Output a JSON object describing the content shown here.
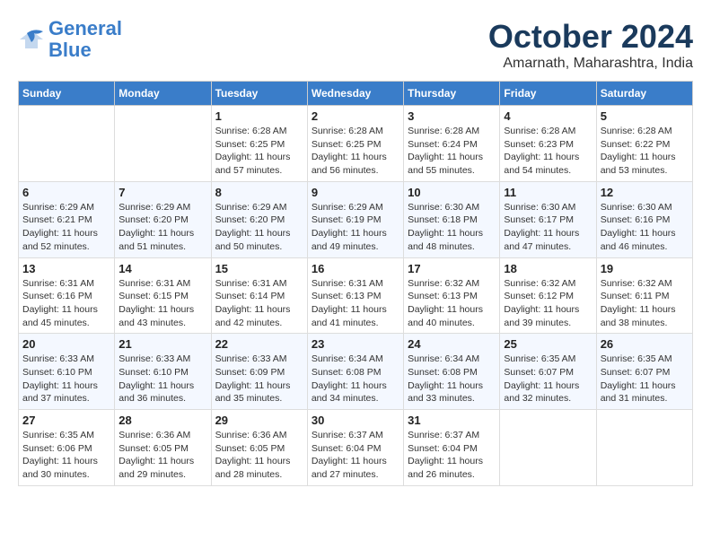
{
  "header": {
    "logo_line1": "General",
    "logo_line2": "Blue",
    "month": "October 2024",
    "location": "Amarnath, Maharashtra, India"
  },
  "days_of_week": [
    "Sunday",
    "Monday",
    "Tuesday",
    "Wednesday",
    "Thursday",
    "Friday",
    "Saturday"
  ],
  "weeks": [
    [
      {
        "day": "",
        "info": ""
      },
      {
        "day": "",
        "info": ""
      },
      {
        "day": "1",
        "info": "Sunrise: 6:28 AM\nSunset: 6:25 PM\nDaylight: 11 hours and 57 minutes."
      },
      {
        "day": "2",
        "info": "Sunrise: 6:28 AM\nSunset: 6:25 PM\nDaylight: 11 hours and 56 minutes."
      },
      {
        "day": "3",
        "info": "Sunrise: 6:28 AM\nSunset: 6:24 PM\nDaylight: 11 hours and 55 minutes."
      },
      {
        "day": "4",
        "info": "Sunrise: 6:28 AM\nSunset: 6:23 PM\nDaylight: 11 hours and 54 minutes."
      },
      {
        "day": "5",
        "info": "Sunrise: 6:28 AM\nSunset: 6:22 PM\nDaylight: 11 hours and 53 minutes."
      }
    ],
    [
      {
        "day": "6",
        "info": "Sunrise: 6:29 AM\nSunset: 6:21 PM\nDaylight: 11 hours and 52 minutes."
      },
      {
        "day": "7",
        "info": "Sunrise: 6:29 AM\nSunset: 6:20 PM\nDaylight: 11 hours and 51 minutes."
      },
      {
        "day": "8",
        "info": "Sunrise: 6:29 AM\nSunset: 6:20 PM\nDaylight: 11 hours and 50 minutes."
      },
      {
        "day": "9",
        "info": "Sunrise: 6:29 AM\nSunset: 6:19 PM\nDaylight: 11 hours and 49 minutes."
      },
      {
        "day": "10",
        "info": "Sunrise: 6:30 AM\nSunset: 6:18 PM\nDaylight: 11 hours and 48 minutes."
      },
      {
        "day": "11",
        "info": "Sunrise: 6:30 AM\nSunset: 6:17 PM\nDaylight: 11 hours and 47 minutes."
      },
      {
        "day": "12",
        "info": "Sunrise: 6:30 AM\nSunset: 6:16 PM\nDaylight: 11 hours and 46 minutes."
      }
    ],
    [
      {
        "day": "13",
        "info": "Sunrise: 6:31 AM\nSunset: 6:16 PM\nDaylight: 11 hours and 45 minutes."
      },
      {
        "day": "14",
        "info": "Sunrise: 6:31 AM\nSunset: 6:15 PM\nDaylight: 11 hours and 43 minutes."
      },
      {
        "day": "15",
        "info": "Sunrise: 6:31 AM\nSunset: 6:14 PM\nDaylight: 11 hours and 42 minutes."
      },
      {
        "day": "16",
        "info": "Sunrise: 6:31 AM\nSunset: 6:13 PM\nDaylight: 11 hours and 41 minutes."
      },
      {
        "day": "17",
        "info": "Sunrise: 6:32 AM\nSunset: 6:13 PM\nDaylight: 11 hours and 40 minutes."
      },
      {
        "day": "18",
        "info": "Sunrise: 6:32 AM\nSunset: 6:12 PM\nDaylight: 11 hours and 39 minutes."
      },
      {
        "day": "19",
        "info": "Sunrise: 6:32 AM\nSunset: 6:11 PM\nDaylight: 11 hours and 38 minutes."
      }
    ],
    [
      {
        "day": "20",
        "info": "Sunrise: 6:33 AM\nSunset: 6:10 PM\nDaylight: 11 hours and 37 minutes."
      },
      {
        "day": "21",
        "info": "Sunrise: 6:33 AM\nSunset: 6:10 PM\nDaylight: 11 hours and 36 minutes."
      },
      {
        "day": "22",
        "info": "Sunrise: 6:33 AM\nSunset: 6:09 PM\nDaylight: 11 hours and 35 minutes."
      },
      {
        "day": "23",
        "info": "Sunrise: 6:34 AM\nSunset: 6:08 PM\nDaylight: 11 hours and 34 minutes."
      },
      {
        "day": "24",
        "info": "Sunrise: 6:34 AM\nSunset: 6:08 PM\nDaylight: 11 hours and 33 minutes."
      },
      {
        "day": "25",
        "info": "Sunrise: 6:35 AM\nSunset: 6:07 PM\nDaylight: 11 hours and 32 minutes."
      },
      {
        "day": "26",
        "info": "Sunrise: 6:35 AM\nSunset: 6:07 PM\nDaylight: 11 hours and 31 minutes."
      }
    ],
    [
      {
        "day": "27",
        "info": "Sunrise: 6:35 AM\nSunset: 6:06 PM\nDaylight: 11 hours and 30 minutes."
      },
      {
        "day": "28",
        "info": "Sunrise: 6:36 AM\nSunset: 6:05 PM\nDaylight: 11 hours and 29 minutes."
      },
      {
        "day": "29",
        "info": "Sunrise: 6:36 AM\nSunset: 6:05 PM\nDaylight: 11 hours and 28 minutes."
      },
      {
        "day": "30",
        "info": "Sunrise: 6:37 AM\nSunset: 6:04 PM\nDaylight: 11 hours and 27 minutes."
      },
      {
        "day": "31",
        "info": "Sunrise: 6:37 AM\nSunset: 6:04 PM\nDaylight: 11 hours and 26 minutes."
      },
      {
        "day": "",
        "info": ""
      },
      {
        "day": "",
        "info": ""
      }
    ]
  ]
}
